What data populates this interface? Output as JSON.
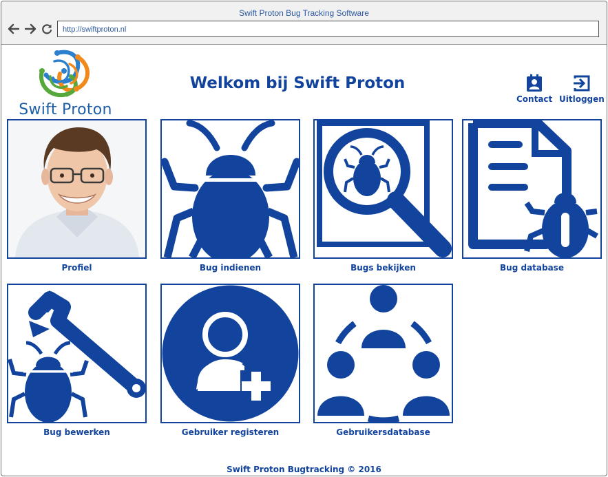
{
  "window": {
    "title": "Swift Proton Bug Tracking Software"
  },
  "browser": {
    "back_icon": "arrow-left-icon",
    "forward_icon": "arrow-right-icon",
    "reload_icon": "reload-icon",
    "url": "http://swiftproton.nl"
  },
  "header": {
    "logo_text": "Swift Proton",
    "title": "Welkom bij Swift Proton",
    "contact_label": "Contact",
    "contact_icon": "contact-card-icon",
    "logout_label": "Uitloggen",
    "logout_icon": "logout-icon"
  },
  "tiles": [
    {
      "label": "Profiel",
      "icon": "profile-photo"
    },
    {
      "label": "Bug indienen",
      "icon": "bug-icon"
    },
    {
      "label": "Bugs bekijken",
      "icon": "magnifier-bug-icon"
    },
    {
      "label": "Bug database",
      "icon": "document-bug-icon"
    },
    {
      "label": "Bug bewerken",
      "icon": "wrench-bug-icon"
    },
    {
      "label": "Gebruiker registeren",
      "icon": "add-user-icon"
    },
    {
      "label": "Gebruikersdatabase",
      "icon": "users-network-icon"
    }
  ],
  "footer": {
    "text": "Swift Proton Bugtracking © 2016"
  },
  "colors": {
    "primary": "#12449e",
    "title_bar": "#f1f1f1",
    "url_text": "#2b58a0",
    "logo_green": "#56a83a",
    "logo_orange": "#f08a1c",
    "logo_blue": "#2a7fcf"
  }
}
